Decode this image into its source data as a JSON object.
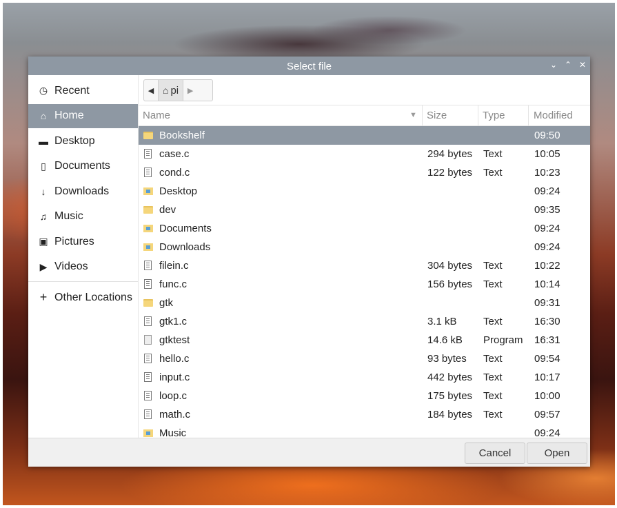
{
  "dialog": {
    "title": "Select file",
    "controls": {
      "minimize": "⌄",
      "maximize": "⌃",
      "close": "✕"
    }
  },
  "sidebar": {
    "items": [
      {
        "label": "Recent",
        "icon": "clock-icon",
        "glyph": "◷"
      },
      {
        "label": "Home",
        "icon": "home-icon",
        "glyph": "⌂",
        "active": true
      },
      {
        "label": "Desktop",
        "icon": "folder-icon",
        "glyph": "▬"
      },
      {
        "label": "Documents",
        "icon": "document-icon",
        "glyph": "▯"
      },
      {
        "label": "Downloads",
        "icon": "download-arrow-icon",
        "glyph": "↓"
      },
      {
        "label": "Music",
        "icon": "music-note-icon",
        "glyph": "♫"
      },
      {
        "label": "Pictures",
        "icon": "camera-icon",
        "glyph": "▣"
      },
      {
        "label": "Videos",
        "icon": "video-icon",
        "glyph": "▶"
      }
    ],
    "other_locations": {
      "label": "Other Locations",
      "glyph": "+"
    }
  },
  "pathbar": {
    "back_glyph": "◀",
    "forward_glyph": "▶",
    "home_glyph": "⌂",
    "current": "pi"
  },
  "file_list": {
    "columns": {
      "name": "Name",
      "size": "Size",
      "type": "Type",
      "modified": "Modified",
      "sort_glyph": "▼"
    },
    "rows": [
      {
        "name": "Bookshelf",
        "size": "",
        "type": "",
        "modified": "09:50",
        "kind": "folder",
        "selected": true
      },
      {
        "name": "case.c",
        "size": "294 bytes",
        "type": "Text",
        "modified": "10:05",
        "kind": "text"
      },
      {
        "name": "cond.c",
        "size": "122 bytes",
        "type": "Text",
        "modified": "10:23",
        "kind": "text"
      },
      {
        "name": "Desktop",
        "size": "",
        "type": "",
        "modified": "09:24",
        "kind": "special-folder"
      },
      {
        "name": "dev",
        "size": "",
        "type": "",
        "modified": "09:35",
        "kind": "folder"
      },
      {
        "name": "Documents",
        "size": "",
        "type": "",
        "modified": "09:24",
        "kind": "special-folder"
      },
      {
        "name": "Downloads",
        "size": "",
        "type": "",
        "modified": "09:24",
        "kind": "special-folder"
      },
      {
        "name": "filein.c",
        "size": "304 bytes",
        "type": "Text",
        "modified": "10:22",
        "kind": "text"
      },
      {
        "name": "func.c",
        "size": "156 bytes",
        "type": "Text",
        "modified": "10:14",
        "kind": "text"
      },
      {
        "name": "gtk",
        "size": "",
        "type": "",
        "modified": "09:31",
        "kind": "folder"
      },
      {
        "name": "gtk1.c",
        "size": "3.1 kB",
        "type": "Text",
        "modified": "16:30",
        "kind": "text"
      },
      {
        "name": "gtktest",
        "size": "14.6 kB",
        "type": "Program",
        "modified": "16:31",
        "kind": "program"
      },
      {
        "name": "hello.c",
        "size": "93 bytes",
        "type": "Text",
        "modified": "09:54",
        "kind": "text"
      },
      {
        "name": "input.c",
        "size": "442 bytes",
        "type": "Text",
        "modified": "10:17",
        "kind": "text"
      },
      {
        "name": "loop.c",
        "size": "175 bytes",
        "type": "Text",
        "modified": "10:00",
        "kind": "text"
      },
      {
        "name": "math.c",
        "size": "184 bytes",
        "type": "Text",
        "modified": "09:57",
        "kind": "text"
      },
      {
        "name": "Music",
        "size": "",
        "type": "",
        "modified": "09:24",
        "kind": "special-folder"
      }
    ]
  },
  "footer": {
    "cancel_label": "Cancel",
    "open_label": "Open"
  }
}
